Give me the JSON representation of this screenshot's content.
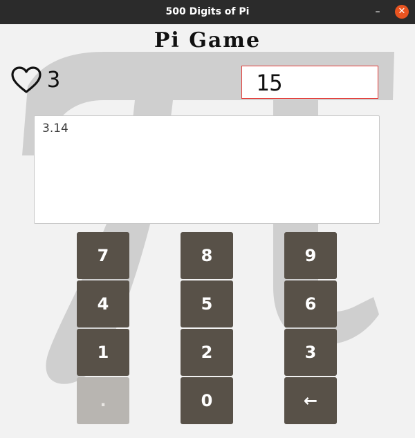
{
  "window": {
    "title": "500 Digits of Pi",
    "minimize_label": "–",
    "close_label": "✕"
  },
  "game": {
    "title": "Pi Game",
    "lives": "3",
    "score": "15",
    "digits": "3.14"
  },
  "keypad": {
    "k7": "7",
    "k8": "8",
    "k9": "9",
    "k4": "4",
    "k5": "5",
    "k6": "6",
    "k1": "1",
    "k2": "2",
    "k3": "3",
    "dot": ".",
    "k0": "0",
    "back": "←"
  },
  "colors": {
    "titlebar": "#2b2b2b",
    "close_button": "#e95420",
    "key_background": "#585148",
    "key_disabled": "#b8b5b1",
    "score_border": "#e53935"
  },
  "icons": {
    "heart": "heart-icon",
    "background": "pi-symbol"
  }
}
